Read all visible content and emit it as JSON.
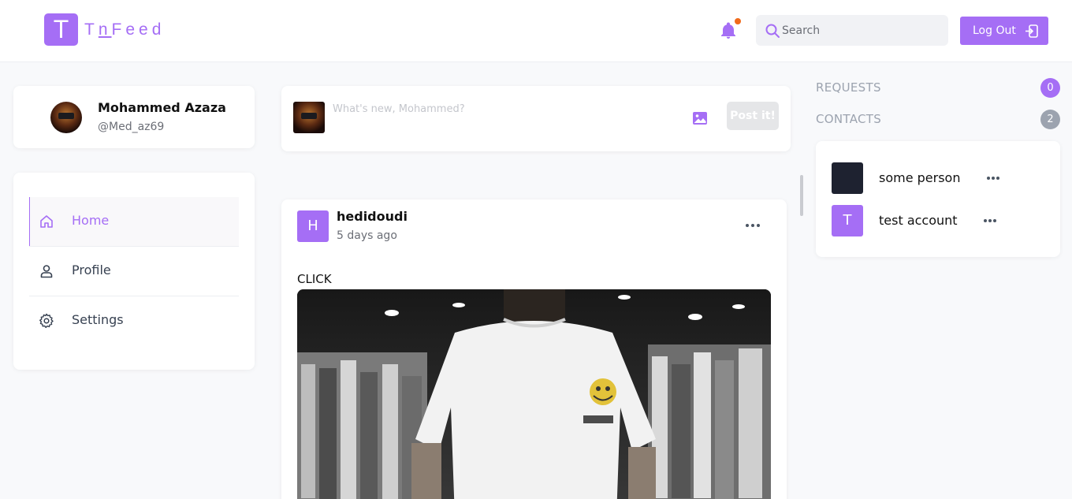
{
  "header": {
    "logo_letter": "T",
    "logo_text_a": "T",
    "logo_text_b": "n",
    "logo_text_c": "Feed",
    "search_placeholder": "Search",
    "logout_label": "Log Out",
    "notification_dot": true
  },
  "profile": {
    "name": "Mohammed Azaza",
    "handle": "@Med_az69"
  },
  "nav": {
    "items": [
      {
        "label": "Home",
        "icon": "home-icon",
        "active": true
      },
      {
        "label": "Profile",
        "icon": "user-icon",
        "active": false
      },
      {
        "label": "Settings",
        "icon": "gear-icon",
        "active": false
      }
    ]
  },
  "composer": {
    "placeholder": "What's new, Mohammed?",
    "post_label": "Post it!"
  },
  "post": {
    "avatar_letter": "H",
    "author": "hedidoudi",
    "time": "5 days ago",
    "text": "CLICK"
  },
  "sidebar": {
    "requests_label": "REQUESTS",
    "requests_count": "0",
    "contacts_label": "CONTACTS",
    "contacts_count": "2",
    "contacts": [
      {
        "name": "some person",
        "avatar_letter": ""
      },
      {
        "name": "test account",
        "avatar_letter": "T"
      }
    ]
  },
  "colors": {
    "accent": "#a56ef5",
    "notification": "#f06a1b",
    "muted_badge": "#9ca3af",
    "dark_avatar": "#1e2230"
  }
}
